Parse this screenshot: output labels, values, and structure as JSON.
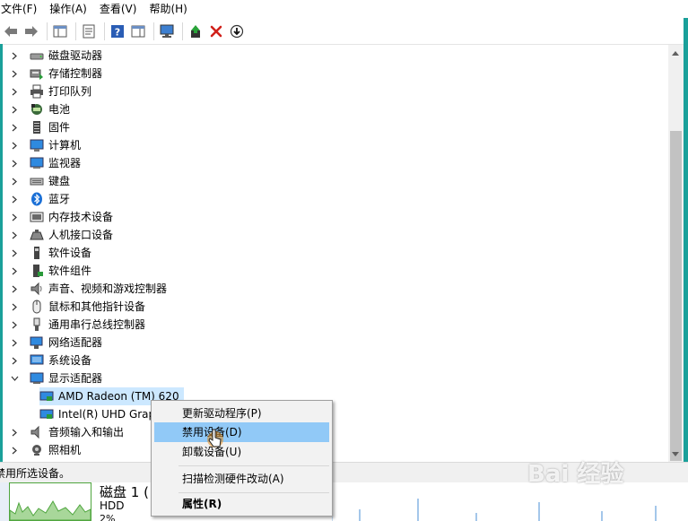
{
  "menubar": {
    "items": [
      {
        "label": "文件(F)"
      },
      {
        "label": "操作(A)"
      },
      {
        "label": "查看(V)"
      },
      {
        "label": "帮助(H)"
      }
    ]
  },
  "toolbar": {
    "buttons": [
      {
        "icon": "back-arrow-icon"
      },
      {
        "icon": "forward-arrow-icon"
      },
      {
        "icon": "show-hide-console-tree-icon"
      },
      {
        "icon": "properties-icon"
      },
      {
        "icon": "help-icon"
      },
      {
        "icon": "action-pane-icon"
      },
      {
        "icon": "scan-hardware-monitor-icon"
      },
      {
        "icon": "update-driver-icon"
      },
      {
        "icon": "uninstall-x-icon"
      },
      {
        "icon": "install-down-arrow-icon"
      }
    ]
  },
  "tree": {
    "categories": [
      {
        "label": "磁盘驱动器",
        "icon": "disk-drive-icon",
        "expanded": false
      },
      {
        "label": "存储控制器",
        "icon": "storage-controller-icon",
        "expanded": false
      },
      {
        "label": "打印队列",
        "icon": "printer-icon",
        "expanded": false
      },
      {
        "label": "电池",
        "icon": "battery-icon",
        "expanded": false
      },
      {
        "label": "固件",
        "icon": "firmware-icon",
        "expanded": false
      },
      {
        "label": "计算机",
        "icon": "computer-icon",
        "expanded": false
      },
      {
        "label": "监视器",
        "icon": "monitor-icon",
        "expanded": false
      },
      {
        "label": "键盘",
        "icon": "keyboard-icon",
        "expanded": false
      },
      {
        "label": "蓝牙",
        "icon": "bluetooth-icon",
        "expanded": false
      },
      {
        "label": "内存技术设备",
        "icon": "memory-device-icon",
        "expanded": false
      },
      {
        "label": "人机接口设备",
        "icon": "hid-icon",
        "expanded": false
      },
      {
        "label": "软件设备",
        "icon": "software-device-icon",
        "expanded": false
      },
      {
        "label": "软件组件",
        "icon": "software-component-icon",
        "expanded": false
      },
      {
        "label": "声音、视频和游戏控制器",
        "icon": "speaker-icon",
        "expanded": false
      },
      {
        "label": "鼠标和其他指针设备",
        "icon": "mouse-icon",
        "expanded": false
      },
      {
        "label": "通用串行总线控制器",
        "icon": "usb-icon",
        "expanded": false
      },
      {
        "label": "网络适配器",
        "icon": "network-adapter-icon",
        "expanded": false
      },
      {
        "label": "系统设备",
        "icon": "system-device-icon",
        "expanded": false
      },
      {
        "label": "显示适配器",
        "icon": "display-adapter-icon",
        "expanded": true
      },
      {
        "label": "AMD Radeon (TM) 620",
        "icon": "gpu-card-icon",
        "child": true,
        "selected": true
      },
      {
        "label": "Intel(R) UHD Grap",
        "icon": "gpu-card-icon",
        "child": true
      },
      {
        "label": "音频输入和输出",
        "icon": "audio-io-icon",
        "expanded": false
      },
      {
        "label": "照相机",
        "icon": "camera-icon",
        "expanded": false
      }
    ]
  },
  "context_menu": {
    "items": [
      {
        "label": "更新驱动程序(P)",
        "highlighted": false,
        "bold": false
      },
      {
        "label": "禁用设备(D)",
        "highlighted": true,
        "bold": false
      },
      {
        "label": "卸载设备(U)",
        "highlighted": false,
        "bold": false
      },
      {
        "label": "扫描检测硬件改动(A)",
        "highlighted": false,
        "bold": false
      },
      {
        "label": "属性(R)",
        "highlighted": false,
        "bold": true
      }
    ]
  },
  "statusbar": {
    "text": "禁用所选设备。"
  },
  "taskmanager": {
    "disk_title": "磁盘 1 (",
    "disk_type": "HDD",
    "disk_usage": "2%"
  },
  "watermark": {
    "text": "Bai 经验"
  },
  "colors": {
    "highlight": "#91c9f7",
    "selection": "#cce8ff",
    "accent_teal": "#1aa09a"
  }
}
